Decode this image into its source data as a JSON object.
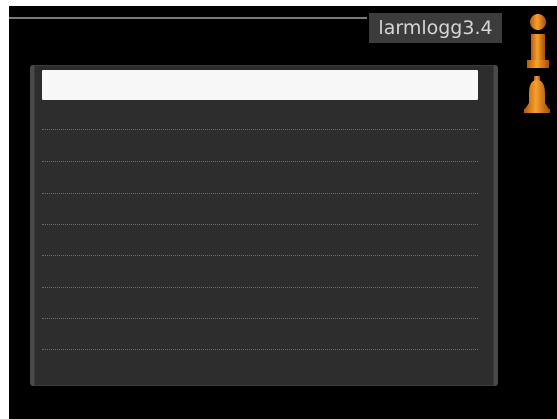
{
  "header": {
    "title": "larmlogg3.4",
    "icons": {
      "info": "info-icon",
      "alarm": "alarm-bell-icon"
    }
  },
  "alarm_log": {
    "rows": [
      "",
      "",
      "",
      "",
      "",
      "",
      "",
      "",
      "",
      ""
    ],
    "selected_index": 0
  },
  "colors": {
    "background": "#000000",
    "title_bg": "#3c3c3c",
    "title_text": "#d6d6d6",
    "accent_orange": "#e8891c",
    "panel_bg": "#2d2d2d",
    "selected_row": "#f7f7f7"
  }
}
